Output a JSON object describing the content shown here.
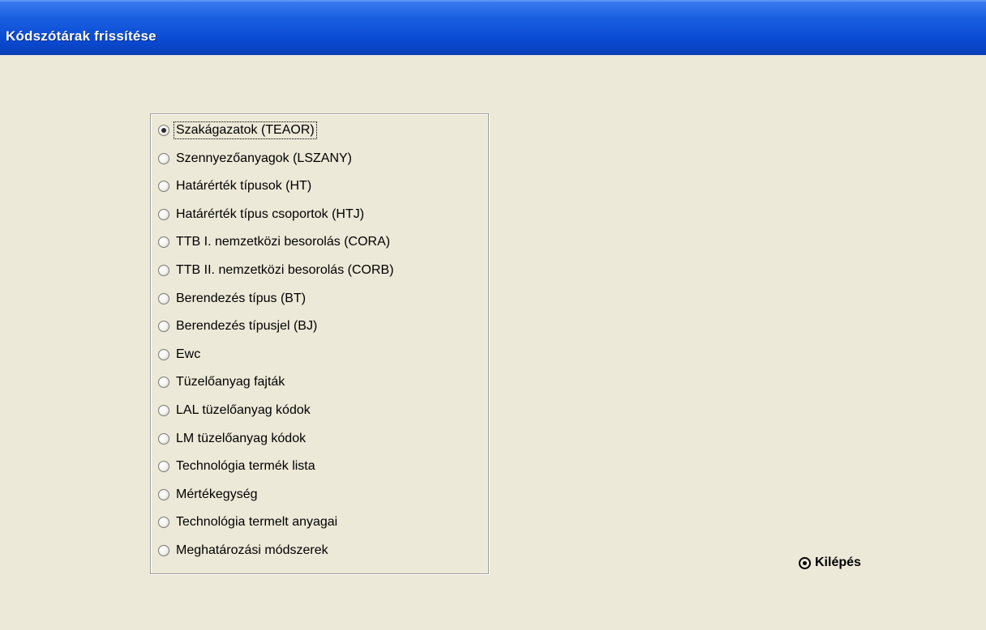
{
  "window": {
    "title": "Kódszótárak frissítése"
  },
  "options": [
    {
      "label": "Szakágazatok (TEAOR)",
      "checked": true
    },
    {
      "label": "Szennyezőanyagok (LSZANY)",
      "checked": false
    },
    {
      "label": "Határérték típusok (HT)",
      "checked": false
    },
    {
      "label": "Határérték típus csoportok (HTJ)",
      "checked": false
    },
    {
      "label": "TTB I. nemzetközi besorolás (CORA)",
      "checked": false
    },
    {
      "label": "TTB II. nemzetközi besorolás (CORB)",
      "checked": false
    },
    {
      "label": "Berendezés típus (BT)",
      "checked": false
    },
    {
      "label": "Berendezés típusjel (BJ)",
      "checked": false
    },
    {
      "label": "Ewc",
      "checked": false
    },
    {
      "label": "Tüzelőanyag fajták",
      "checked": false
    },
    {
      "label": "LAL tüzelőanyag kódok",
      "checked": false
    },
    {
      "label": "LM tüzelőanyag kódok",
      "checked": false
    },
    {
      "label": "Technológia termék lista",
      "checked": false
    },
    {
      "label": "Mértékegység",
      "checked": false
    },
    {
      "label": "Technológia termelt anyagai",
      "checked": false
    },
    {
      "label": "Meghatározási módszerek",
      "checked": false
    }
  ],
  "exit": {
    "label": "Kilépés",
    "icon": "target-circle-icon"
  },
  "colors": {
    "background": "#ece9d8",
    "titlebar": "#0a4bd4"
  }
}
